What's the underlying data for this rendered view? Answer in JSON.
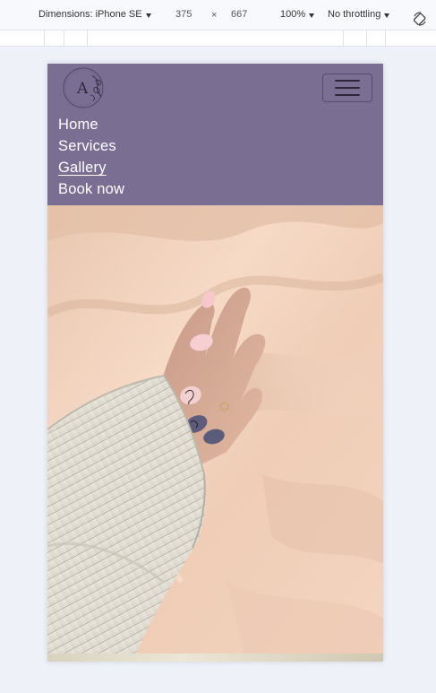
{
  "devtools": {
    "device_label": "Dimensions: iPhone SE",
    "width": "375",
    "times": "×",
    "height": "667",
    "zoom": "100%",
    "throttling": "No throttling"
  },
  "navbar": {
    "logo_letter": "A",
    "links": [
      {
        "label": "Home"
      },
      {
        "label": "Services"
      },
      {
        "label": "Gallery"
      },
      {
        "label": "Book now"
      }
    ],
    "active_index": 2,
    "background": "#7a6f93"
  },
  "colors": {
    "nav_bg": "#7a6f93",
    "page_bg": "#eef1f8"
  }
}
